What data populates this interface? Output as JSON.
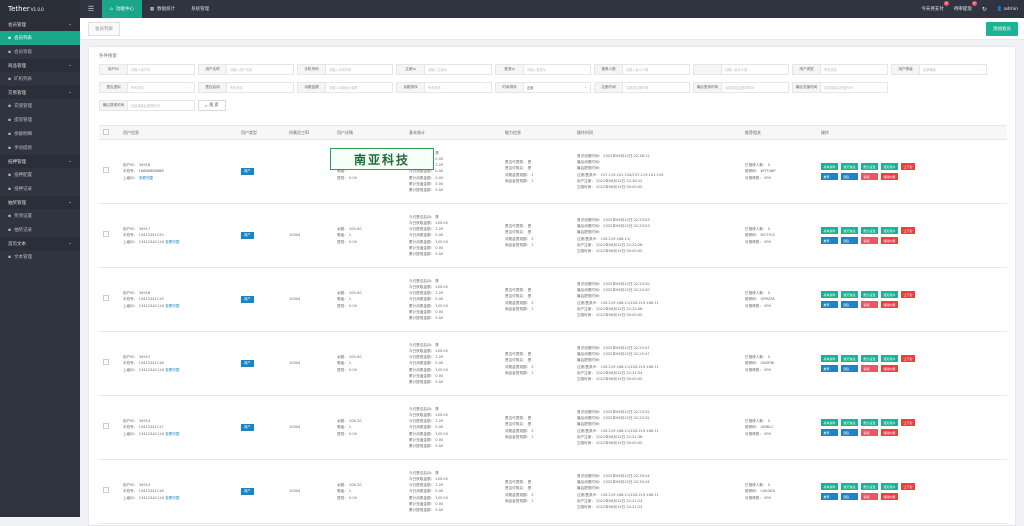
{
  "app": {
    "title": "Tether",
    "version": "V1.0.0"
  },
  "nav": {
    "tabs": [
      {
        "label": "功能中心",
        "icon": "home-icon"
      },
      {
        "label": "数据统计",
        "icon": "chart-icon"
      },
      {
        "label": "系统管理",
        "icon": ""
      }
    ]
  },
  "topright": {
    "withdraw": "今天待支付",
    "withdraw_badge": "0",
    "review": "待审提现",
    "review_badge": "0",
    "user": "admin"
  },
  "sidebar": [
    {
      "group": "会员管理",
      "items": [
        {
          "label": "会员列表",
          "active": true
        },
        {
          "label": "会员等级"
        }
      ]
    },
    {
      "group": "商品管理",
      "items": [
        {
          "label": "矿机列表"
        }
      ]
    },
    {
      "group": "交易管理",
      "items": [
        {
          "label": "充值管理"
        },
        {
          "label": "提现管理"
        },
        {
          "label": "余额明细"
        },
        {
          "label": "手动提款"
        }
      ]
    },
    {
      "group": "抵押管理",
      "items": [
        {
          "label": "抵押配置"
        },
        {
          "label": "抵押记录"
        }
      ]
    },
    {
      "group": "抽奖管理",
      "items": [
        {
          "label": "奖项设置"
        },
        {
          "label": "抽奖记录"
        }
      ]
    },
    {
      "group": "首页文本",
      "items": [
        {
          "label": "文本管理"
        }
      ]
    }
  ],
  "crumb": "会员列表",
  "add_button": "添加会员",
  "filters": {
    "title": "条件搜索",
    "row1": [
      {
        "label": "用户ID",
        "ph": "请输入用户ID"
      },
      {
        "label": "用户名称",
        "ph": "请输入用户名称"
      },
      {
        "label": "手机号码",
        "ph": "请输入手机号码"
      },
      {
        "label": "注册ip",
        "ph": "请输入注册ip"
      },
      {
        "label": "登录ip",
        "ph": "请输入登录ip"
      },
      {
        "label": "推荐人数",
        "ph": "请输入最小人数"
      },
      {
        "label": "",
        "ph": "请输入最大人数"
      },
      {
        "label": "用户类型",
        "ph": "所有状态"
      },
      {
        "label": "用户等级",
        "ph": "全部等级"
      }
    ],
    "row2": [
      {
        "label": "是否虚拟",
        "ph": "所有状态"
      },
      {
        "label": "是否启用",
        "ph": "所有状态"
      },
      {
        "label": "余额金额",
        "ph": "请输入余额最小金额"
      },
      {
        "label": "余额排序",
        "ph": "所有状态"
      },
      {
        "label": "时间排序",
        "ph": "正序",
        "val": true
      },
      {
        "label": "注册时间",
        "ph": "请选择注册时间"
      },
      {
        "label": "最后登录时间",
        "ph": "请选择最后登录时间"
      },
      {
        "label": "最后充值时间",
        "ph": "请选择最后充值时间"
      }
    ],
    "row3": [
      {
        "label": "最后提现时间",
        "ph": "请选择最后提现时间"
      }
    ],
    "search": "搜 索"
  },
  "table": {
    "headers": [
      "",
      "用户信息",
      "用户类型",
      "所属员工ID",
      "用户详情",
      "基本统计",
      "能力信息",
      "操作时间",
      "推荐相关",
      "操作"
    ],
    "rows": [
      {
        "uid": "用户ID： 34918",
        "phone": "手机号： 18888888888",
        "parent": "上级ID：",
        "type": "用户",
        "staff": "",
        "detail": [
          "余额：",
          "等级：",
          "提现： 0.00"
        ],
        "stats": [
          "今日是否启动： 是",
          "今日获取金额： 0.00",
          "今日提现金额： 1.20",
          "今日消费金额： 0.00",
          "累计消费金额： 0.00",
          "累计充值金额： 0.00",
          "累计提现金额： 0.00"
        ],
        "ability": [
          "是否可提现： 是",
          "是否可购买： 是",
          "消费金提现额： 1",
          "商品金提现额： 1"
        ],
        "times": [
          "首次消费时间： 2022年06月12日 22:36:12",
          "最后消费时间：",
          "最后提现时间：",
          "注册/登录IP： 157.119.101.154/157.119.101.154",
          "用户注册： 2022年06月12日 22:36:12",
          "交易时间： 2022年06月15日 00:00:00"
        ],
        "ref": [
          "已推荐人数： 0",
          "推荐码： WYT4NP",
          "可推荐数： 999"
        ]
      },
      {
        "uid": "用户ID： 34917",
        "phone": "手机号： 13412341120",
        "parent": "上级ID： 13412341118",
        "type": "用户",
        "staff": "10004",
        "detail": [
          "余额： 105.00",
          "等级： 1",
          "提现： 0.00"
        ],
        "stats": [
          "今日是否启动： 是",
          "今日获取金额： 105.00",
          "今日提现金额： 1.20",
          "今日消费金额： 0.00",
          "累计消费金额： 105.00",
          "累计充值金额： 0.00",
          "累计提现金额： 0.00"
        ],
        "ability": [
          "是否可提现： 是",
          "是否可购买： 是",
          "消费金提现额： 5",
          "商品金提现额： 1"
        ],
        "times": [
          "首次消费时间： 2022年06月12日 22:23:03",
          "最后消费时间： 2022年06月12日 22:23:03",
          "最后提现时间：",
          "注册/登录IP： 154.219.166.11/",
          "用户注册： 2022年06月12日 22:22:28",
          "交易时间： 2022年06月15日 00:00:00"
        ],
        "ref": [
          "已推荐人数： 0",
          "推荐码： MCTYLS",
          "可推荐数： 999"
        ]
      },
      {
        "uid": "用户ID： 34916",
        "phone": "手机号： 13412341119",
        "parent": "上级ID： 13412341118",
        "type": "用户",
        "staff": "10004",
        "detail": [
          "余额： 105.00",
          "等级： 1",
          "提现： 0.00"
        ],
        "stats": [
          "今日是否启动： 是",
          "今日获取金额： 105.00",
          "今日提现金额： 1.20",
          "今日消费金额： 0.00",
          "累计消费金额： 105.00",
          "累计充值金额： 0.00",
          "累计提现金额： 0.00"
        ],
        "ability": [
          "是否可提现： 是",
          "是否可购买： 是",
          "消费金提现额： 5",
          "商品金提现额： 1"
        ],
        "times": [
          "首次消费时间： 2022年06月12日 22:24:20",
          "最后消费时间： 2022年06月12日 22:24:20",
          "最后提现时间：",
          "注册/登录IP： 154.219.166.11/154.219.166.11",
          "用户注册： 2022年06月12日 22:22:08",
          "交易时间： 2022年06月15日 00:00:00"
        ],
        "ref": [
          "已推荐人数： 0",
          "推荐码： QPRZFA",
          "可推荐数： 999"
        ]
      },
      {
        "uid": "用户ID： 34915",
        "phone": "手机号： 13412341118",
        "parent": "上级ID： 13412341118",
        "type": "用户",
        "staff": "10004",
        "detail": [
          "余额： 105.00",
          "等级： 1",
          "提现： 0.00"
        ],
        "stats": [
          "今日是否启动： 是",
          "今日获取金额： 105.00",
          "今日提现金额： 1.20",
          "今日消费金额： 0.00",
          "累计消费金额： 105.00",
          "累计充值金额： 0.00",
          "累计提现金额： 0.00"
        ],
        "ability": [
          "是否可提现： 是",
          "是否可购买： 是",
          "消费金提现额： 5",
          "商品金提现额： 1"
        ],
        "times": [
          "首次消费时间： 2022年06月12日 22:25:47",
          "最后消费时间： 2022年06月12日 22:25:47",
          "最后提现时间：",
          "注册/登录IP： 154.219.166.11/154.219.166.11",
          "用户注册： 2022年06月12日 22:21:54",
          "交易时间： 2022年06月15日 00:00:00"
        ],
        "ref": [
          "已推荐人数： 0",
          "推荐码： UNSRNI",
          "可推荐数： 999"
        ]
      },
      {
        "uid": "用户ID： 34914",
        "phone": "手机号： 13412341117",
        "parent": "上级ID： 13412341118",
        "type": "用户",
        "staff": "10004",
        "detail": [
          "余额： 106.20",
          "等级： 1",
          "提现： 0.00"
        ],
        "stats": [
          "今日是否启动： 是",
          "今日获取金额： 105.00",
          "今日提现金额： 1.20",
          "今日消费金额： 0.00",
          "累计消费金额： 105.00",
          "累计充值金额： 0.00",
          "累计提现金额： 0.00"
        ],
        "ability": [
          "是否可提现： 是",
          "是否可购买： 是",
          "消费金提现额： 5",
          "商品金提现额： 1"
        ],
        "times": [
          "首次消费时间： 2022年06月12日 22:23:32",
          "最后消费时间： 2022年06月12日 22:23:32",
          "最后提现时间：",
          "注册/登录IP： 154.219.166.11/154.219.166.11",
          "用户注册： 2022年06月12日 22:21:38",
          "交易时间： 2022年06月15日 00:00:00"
        ],
        "ref": [
          "已推荐人数： 0",
          "推荐码： GIBKLC",
          "可推荐数： 999"
        ]
      },
      {
        "uid": "用户ID： 34913",
        "phone": "手机号： 13412341116",
        "parent": "上级ID： 13412341118",
        "type": "用户",
        "staff": "10004",
        "detail": [
          "余额： 106.20",
          "等级： 1",
          "提现： 0.00"
        ],
        "stats": [
          "今日是否启动： 是",
          "今日获取金额： 105.00",
          "今日提现金额： 1.20",
          "今日消费金额： 0.00",
          "累计消费金额： 105.00",
          "累计充值金额： 0.00",
          "累计提现金额： 0.00"
        ],
        "ability": [
          "是否可提现： 是",
          "是否可购买： 是",
          "消费金提现额： 5",
          "商品金提现额： 1"
        ],
        "times": [
          "首次消费时间： 2022年06月12日 22:39:24",
          "最后消费时间： 2022年06月12日 22:39:24",
          "最后提现时间：",
          "注册/登录IP： 154.219.166.11/154.219.166.11",
          "用户注册： 2022年06月12日 22:21:23",
          "交易时间： 2022年06月15日 22:21:23"
        ],
        "ref": [
          "已推荐人数： 0",
          "推荐码： LHKQEA",
          "可推荐数： 999"
        ]
      }
    ],
    "view_link": "查看完整",
    "ops": [
      {
        "label": "基本资料",
        "c": "g"
      },
      {
        "label": "银行信息",
        "c": "g"
      },
      {
        "label": "能力设置",
        "c": "g"
      },
      {
        "label": "锁定用户",
        "c": "g"
      },
      {
        "label": "上下分",
        "c": "rr"
      },
      {
        "label": "推荐",
        "c": "b"
      },
      {
        "label": "团队",
        "c": "b"
      },
      {
        "label": "禁用",
        "c": "r"
      },
      {
        "label": "移除内幕",
        "c": "rr"
      }
    ]
  },
  "stamp": "南亚科技"
}
